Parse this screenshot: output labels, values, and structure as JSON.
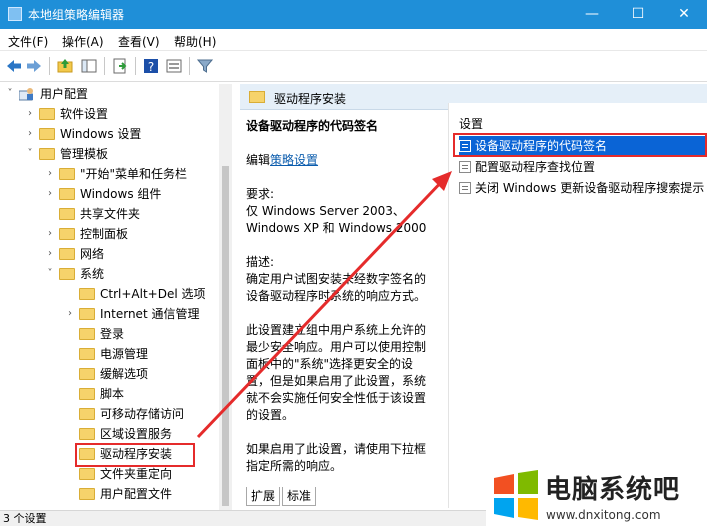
{
  "window": {
    "title": "本地组策略编辑器",
    "minimize": "—",
    "maximize": "☐",
    "close": "✕"
  },
  "menu": [
    "文件(F)",
    "操作(A)",
    "查看(V)",
    "帮助(H)"
  ],
  "tree": [
    {
      "label": "用户配置",
      "level": 0,
      "chevron": "˅",
      "icon": "user-config"
    },
    {
      "label": "软件设置",
      "level": 1,
      "chevron": "›"
    },
    {
      "label": "Windows 设置",
      "level": 1,
      "chevron": "›"
    },
    {
      "label": "管理模板",
      "level": 1,
      "chevron": "˅"
    },
    {
      "label": "\"开始\"菜单和任务栏",
      "level": 2,
      "chevron": "›"
    },
    {
      "label": "Windows 组件",
      "level": 2,
      "chevron": "›"
    },
    {
      "label": "共享文件夹",
      "level": 2,
      "chevron": ""
    },
    {
      "label": "控制面板",
      "level": 2,
      "chevron": "›"
    },
    {
      "label": "网络",
      "level": 2,
      "chevron": "›"
    },
    {
      "label": "系统",
      "level": 2,
      "chevron": "˅"
    },
    {
      "label": "Ctrl+Alt+Del 选项",
      "level": 3,
      "chevron": ""
    },
    {
      "label": "Internet 通信管理",
      "level": 3,
      "chevron": "›"
    },
    {
      "label": "登录",
      "level": 3,
      "chevron": ""
    },
    {
      "label": "电源管理",
      "level": 3,
      "chevron": ""
    },
    {
      "label": "缓解选项",
      "level": 3,
      "chevron": ""
    },
    {
      "label": "脚本",
      "level": 3,
      "chevron": ""
    },
    {
      "label": "可移动存储访问",
      "level": 3,
      "chevron": ""
    },
    {
      "label": "区域设置服务",
      "level": 3,
      "chevron": ""
    },
    {
      "label": "驱动程序安装",
      "level": 3,
      "chevron": ""
    },
    {
      "label": "文件夹重定向",
      "level": 3,
      "chevron": ""
    },
    {
      "label": "用户配置文件",
      "level": 3,
      "chevron": ""
    }
  ],
  "right": {
    "header": "驱动程序安装",
    "desc_title": "设备驱动程序的代码签名",
    "edit_prefix": "编辑",
    "edit_link": "策略设置",
    "req_label": "要求:",
    "req_lines": [
      "仅 Windows Server 2003、",
      "Windows XP 和 Windows 2000"
    ],
    "desc_label": "描述:",
    "desc_lines": [
      "确定用户试图安装未经数字签名的",
      "设备驱动程序时系统的响应方式。"
    ],
    "para2": [
      "此设置建立组中用户系统上允许的",
      "最少安全响应。用户可以使用控制",
      "面板中的\"系统\"选择更安全的设",
      "置，但是如果启用了此设置，系统",
      "就不会实施任何安全性低于该设置",
      "的设置。"
    ],
    "para3": [
      "如果启用了此设置，请使用下拉框",
      "指定所需的响应。"
    ],
    "settings_head": "设置",
    "settings": [
      "设备驱动程序的代码签名",
      "配置驱动程序查找位置",
      "关闭 Windows 更新设备驱动程序搜索提示"
    ],
    "tabs": [
      "扩展",
      "标准"
    ]
  },
  "status": "3 个设置",
  "watermark": {
    "brand": "电脑系统吧",
    "url": "www.dnxitong.com"
  },
  "colors": {
    "titlebar": "#1f8fd8",
    "selection": "#0a64d6",
    "annotation": "#e52b2b"
  }
}
